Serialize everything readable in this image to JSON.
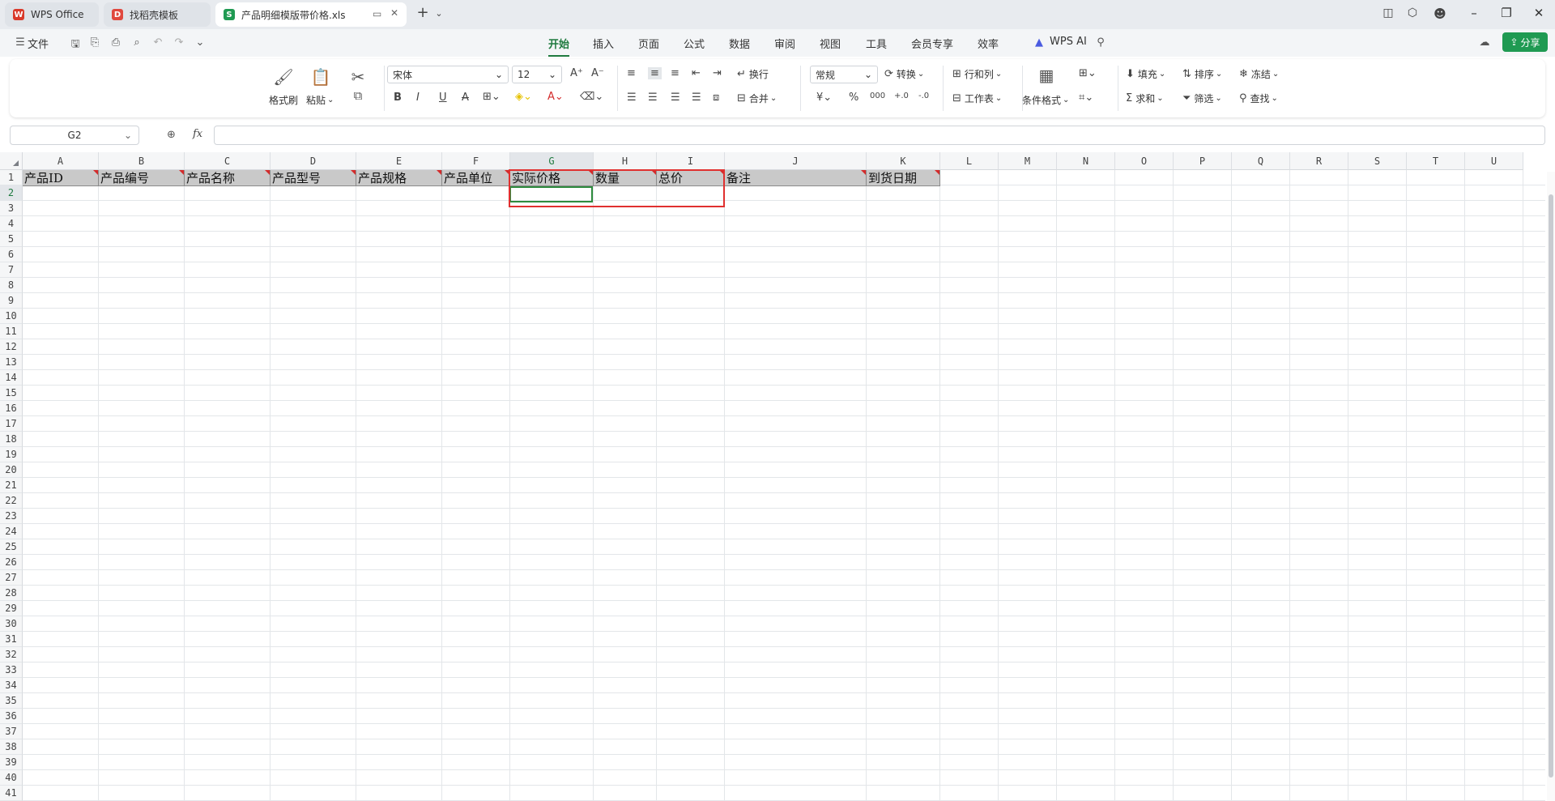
{
  "tabs": [
    {
      "label": "WPS Office",
      "icon": "wps-logo-icon",
      "color": "#d93a2b"
    },
    {
      "label": "找稻壳模板",
      "icon": "docer-icon",
      "color": "#e0483e"
    },
    {
      "label": "产品明细模版带价格.xls",
      "icon": "spreadsheet-icon",
      "color": "#1f9a52",
      "active": true
    }
  ],
  "menu": {
    "file_label": "文件",
    "tabs": [
      "开始",
      "插入",
      "页面",
      "公式",
      "数据",
      "审阅",
      "视图",
      "工具",
      "会员专享",
      "效率"
    ],
    "active_tab": "开始",
    "ai_label": "WPS AI",
    "share_label": "分享"
  },
  "ribbon": {
    "format_painter": "格式刷",
    "paste": "粘贴",
    "font_name": "宋体",
    "font_size": "12",
    "wrap": "换行",
    "merge": "合并",
    "number_format": "常规",
    "convert": "转换",
    "rows_cols": "行和列",
    "worksheet": "工作表",
    "cond_format": "条件格式",
    "fill": "填充",
    "sort": "排序",
    "freeze": "冻结",
    "sum": "求和",
    "filter": "筛选",
    "find": "查找"
  },
  "formula_bar": {
    "cell_ref": "G2",
    "fx_label": "fx",
    "value": ""
  },
  "sheet": {
    "columns": [
      "A",
      "B",
      "C",
      "D",
      "E",
      "F",
      "G",
      "H",
      "I",
      "J",
      "K",
      "L",
      "M",
      "N",
      "O",
      "P",
      "Q",
      "R",
      "S",
      "T",
      "U"
    ],
    "selected_column": "G",
    "selected_row": "2",
    "rows": [
      "1",
      "2",
      "3",
      "4",
      "5",
      "6",
      "7",
      "8",
      "9",
      "10",
      "11",
      "12",
      "13",
      "14",
      "15",
      "16",
      "17",
      "18",
      "19",
      "20",
      "21",
      "22",
      "23",
      "24",
      "25",
      "26",
      "27",
      "28",
      "29",
      "30",
      "31",
      "32",
      "33",
      "34",
      "35",
      "36",
      "37",
      "38",
      "39",
      "40",
      "41"
    ],
    "header_row": [
      "产品ID",
      "产品编号",
      "产品名称",
      "产品型号",
      "产品规格",
      "产品单位",
      "实际价格",
      "数量",
      "总价",
      "备注",
      "到货日期"
    ]
  },
  "colors": {
    "accent": "#1f7a3f",
    "header_fill": "#c9c9c9",
    "highlight_box": "#e0302f",
    "comment_marker": "#d42b2b"
  }
}
